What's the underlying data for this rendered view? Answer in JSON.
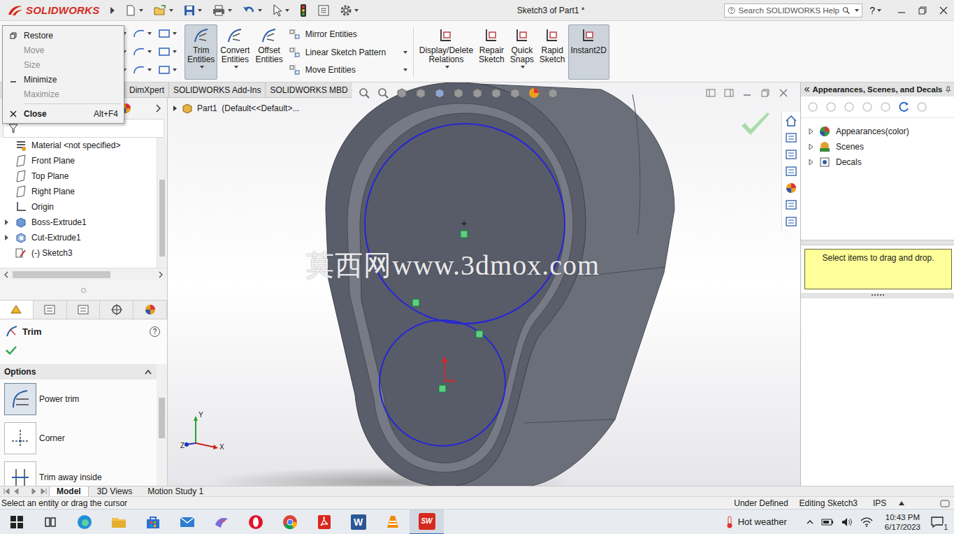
{
  "window": {
    "app": "SOLIDWORKS",
    "title": "Sketch3 of Part1 *"
  },
  "search": {
    "placeholder": "Search SOLIDWORKS Help"
  },
  "help_button": "?",
  "system_menu": [
    {
      "label": "Restore",
      "disabled": false
    },
    {
      "label": "Move",
      "disabled": true
    },
    {
      "label": "Size",
      "disabled": true
    },
    {
      "label": "Minimize",
      "disabled": false
    },
    {
      "label": "Maximize",
      "disabled": true
    },
    {
      "label": "Close",
      "shortcut": "Alt+F4",
      "disabled": false
    }
  ],
  "ribbon": {
    "tools_left": [
      {
        "label": "Trim Entities",
        "selected": true,
        "dropdown": true
      },
      {
        "label": "Convert Entities",
        "selected": false,
        "dropdown": true
      },
      {
        "label": "Offset Entities",
        "selected": false,
        "dropdown": false
      }
    ],
    "stack": [
      {
        "label": "Mirror Entities",
        "dropdown": false
      },
      {
        "label": "Linear Sketch Pattern",
        "dropdown": true
      },
      {
        "label": "Move Entities",
        "dropdown": true
      }
    ],
    "tools_right": [
      {
        "label": "Display/Delete Relations",
        "selected": false,
        "dropdown": true
      },
      {
        "label": "Repair Sketch",
        "selected": false,
        "dropdown": false
      },
      {
        "label": "Quick Snaps",
        "selected": false,
        "dropdown": true
      },
      {
        "label": "Rapid Sketch",
        "selected": false,
        "dropdown": false
      },
      {
        "label": "Instant2D",
        "selected": true,
        "dropdown": false
      }
    ]
  },
  "command_tabs": [
    {
      "label": "DimXpert",
      "selected": false
    },
    {
      "label": "SOLIDWORKS Add-Ins",
      "selected": false
    },
    {
      "label": "SOLIDWORKS MBD",
      "selected": false
    }
  ],
  "feature_tree": [
    {
      "label": "Material <not specified>",
      "kind": "material",
      "expandable": false
    },
    {
      "label": "Front Plane",
      "kind": "plane",
      "expandable": false
    },
    {
      "label": "Top Plane",
      "kind": "plane",
      "expandable": false
    },
    {
      "label": "Right Plane",
      "kind": "plane",
      "expandable": false
    },
    {
      "label": "Origin",
      "kind": "origin",
      "expandable": false
    },
    {
      "label": "Boss-Extrude1",
      "kind": "boss",
      "expandable": true
    },
    {
      "label": "Cut-Extrude1",
      "kind": "cut",
      "expandable": true
    },
    {
      "label": "(-) Sketch3",
      "kind": "sketch",
      "expandable": false
    }
  ],
  "property_manager": {
    "title": "Trim",
    "help": "?",
    "section": "Options",
    "options": [
      {
        "label": "Power trim",
        "kind": "power",
        "selected": true
      },
      {
        "label": "Corner",
        "kind": "corner",
        "selected": false
      },
      {
        "label": "Trim away inside",
        "kind": "inside",
        "selected": false
      }
    ]
  },
  "viewport": {
    "breadcrumb": "Part1  (Default<<Default>...",
    "watermark": "莫西网www.3dmox.com",
    "triad": {
      "x": "X",
      "y": "Y",
      "z": "Z"
    }
  },
  "task_pane": {
    "title": "Appearances, Scenes, and Decals",
    "tree": [
      {
        "label": "Appearances(color)",
        "kind": "appearances"
      },
      {
        "label": "Scenes",
        "kind": "scenes"
      },
      {
        "label": "Decals",
        "kind": "decals"
      }
    ],
    "hint": "Select items to drag and drop."
  },
  "bottom_tabs": [
    {
      "label": "Model",
      "selected": true
    },
    {
      "label": "3D Views",
      "selected": false
    },
    {
      "label": "Motion Study 1",
      "selected": false
    }
  ],
  "status_bar": {
    "message": "Select an entity or drag the cursor",
    "sketch_state": "Under Defined",
    "mode": "Editing Sketch3",
    "units": "IPS"
  },
  "taskbar": {
    "apps": [
      {
        "kind": "edge",
        "active": false
      },
      {
        "kind": "explorer",
        "active": false
      },
      {
        "kind": "store",
        "active": false
      },
      {
        "kind": "mail",
        "active": false
      },
      {
        "kind": "paint",
        "active": false
      },
      {
        "kind": "opera",
        "active": false
      },
      {
        "kind": "chrome",
        "active": false
      },
      {
        "kind": "acrobat",
        "active": false
      },
      {
        "kind": "word",
        "label": "W",
        "active": false
      },
      {
        "kind": "vlc",
        "active": false
      },
      {
        "kind": "solidworks",
        "label": "SW",
        "active": true
      }
    ],
    "weather": "Hot weather",
    "time": "10:43 PM",
    "date": "6/17/2023",
    "notifications": "1"
  }
}
